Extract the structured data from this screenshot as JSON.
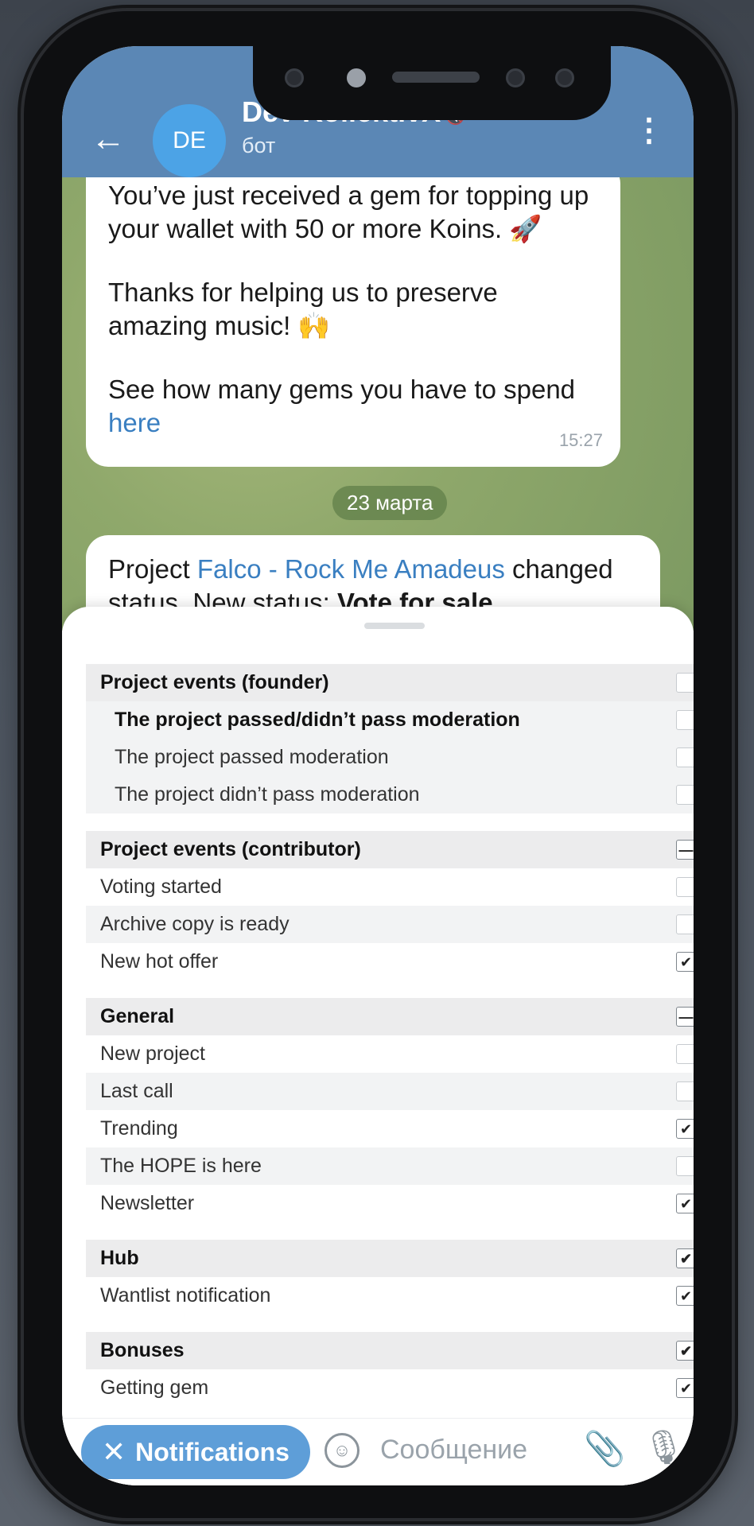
{
  "header": {
    "back_icon": "←",
    "avatar_initials": "DE",
    "title": "Dev KollektivX",
    "mute_icon": "🔇",
    "subtitle": "бот",
    "more_icon": "⋮"
  },
  "messages": {
    "first": {
      "para1": "You’ve just received a gem for topping up your wallet with 50 or more Koins. 🚀",
      "para2": "Thanks for helping us to preserve amazing music! 🙌",
      "para3_text": "See how many gems you have to spend",
      "para3_link": "here",
      "time": "15:27"
    },
    "date_divider": "23 марта",
    "second": {
      "prefix": "Project ",
      "link": "Falco - Rock Me Amadeus",
      "suffix": " changed status. New status: ",
      "status": "Vote for sale"
    }
  },
  "settings": {
    "groups": [
      {
        "title": "Project events (founder)",
        "state": "empty",
        "items": [
          {
            "label": "The project passed/didn’t pass moderation",
            "state": "empty",
            "bold": true
          },
          {
            "label": "The project passed moderation",
            "state": "empty",
            "bold": false
          },
          {
            "label": "The project didn’t pass moderation",
            "state": "empty",
            "bold": false
          }
        ]
      },
      {
        "title": "Project events (contributor)",
        "state": "partial",
        "items": [
          {
            "label": "Voting started",
            "state": "empty"
          },
          {
            "label": "Archive copy is ready",
            "state": "empty"
          },
          {
            "label": "New hot offer",
            "state": "checked"
          }
        ]
      },
      {
        "title": "General",
        "state": "partial",
        "items": [
          {
            "label": "New project",
            "state": "empty"
          },
          {
            "label": "Last call",
            "state": "empty"
          },
          {
            "label": "Trending",
            "state": "checked"
          },
          {
            "label": "The HOPE is here",
            "state": "empty"
          },
          {
            "label": "Newsletter",
            "state": "checked"
          }
        ]
      },
      {
        "title": "Hub",
        "state": "checked",
        "items": [
          {
            "label": "Wantlist notification",
            "state": "checked"
          }
        ]
      },
      {
        "title": "Bonuses",
        "state": "checked",
        "items": [
          {
            "label": "Getting gem",
            "state": "checked"
          }
        ]
      }
    ]
  },
  "input_bar": {
    "notifications_button": "Notifications",
    "close_icon": "✕",
    "emoji_icon": "☺",
    "placeholder": "Сообщение",
    "attach_icon": "📎",
    "mic_icon": "🎙"
  },
  "colors": {
    "header": "#5b87b5",
    "accent": "#5e9ed8",
    "link": "#3a7fc1"
  }
}
